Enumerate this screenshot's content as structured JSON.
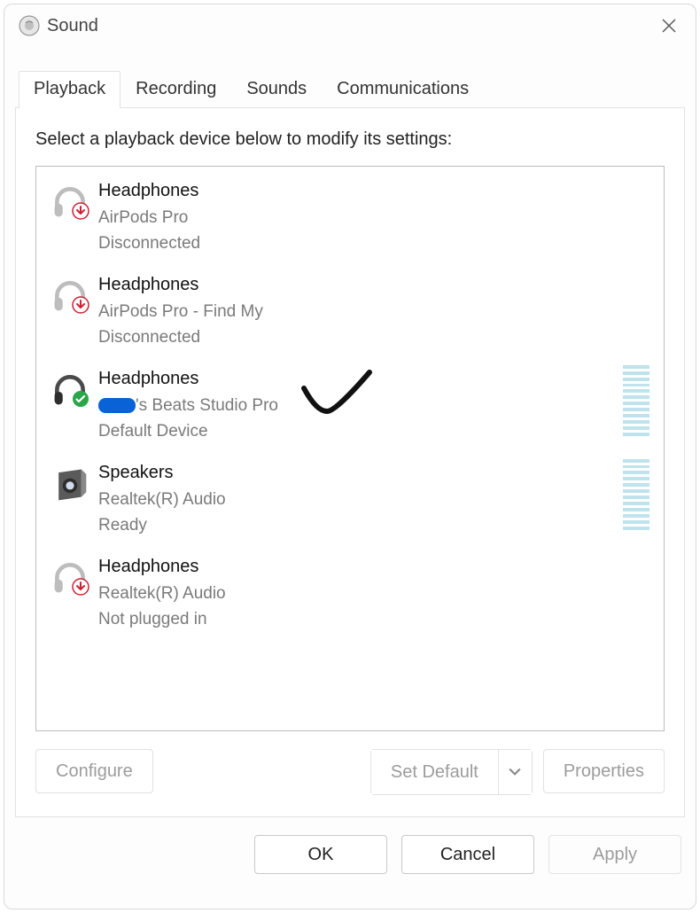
{
  "window": {
    "title": "Sound",
    "close_icon": "close-icon"
  },
  "tabs": [
    {
      "label": "Playback",
      "active": true
    },
    {
      "label": "Recording",
      "active": false
    },
    {
      "label": "Sounds",
      "active": false
    },
    {
      "label": "Communications",
      "active": false
    }
  ],
  "instruction": "Select a playback device below to modify its settings:",
  "devices": [
    {
      "name": "Headphones",
      "sub": "AirPods Pro",
      "status": "Disconnected",
      "icon": "headphones-gray",
      "badge": "down-red",
      "meter": false
    },
    {
      "name": "Headphones",
      "sub": "AirPods Pro - Find My",
      "status": "Disconnected",
      "icon": "headphones-gray",
      "badge": "down-red",
      "meter": false
    },
    {
      "name": "Headphones",
      "sub_redacted_prefix": "xxxx",
      "sub_suffix": "'s Beats Studio Pro",
      "status": "Default Device",
      "icon": "headphones-dark",
      "badge": "check-green",
      "meter": true
    },
    {
      "name": "Speakers",
      "sub": "Realtek(R) Audio",
      "status": "Ready",
      "icon": "speaker",
      "badge": null,
      "meter": true
    },
    {
      "name": "Headphones",
      "sub": "Realtek(R) Audio",
      "status": "Not plugged in",
      "icon": "headphones-gray",
      "badge": "down-red",
      "meter": false
    }
  ],
  "panel_buttons": {
    "configure": "Configure",
    "set_default": "Set Default",
    "properties": "Properties"
  },
  "dialog_buttons": {
    "ok": "OK",
    "cancel": "Cancel",
    "apply": "Apply"
  },
  "annotation": {
    "type": "hand-drawn-check"
  }
}
